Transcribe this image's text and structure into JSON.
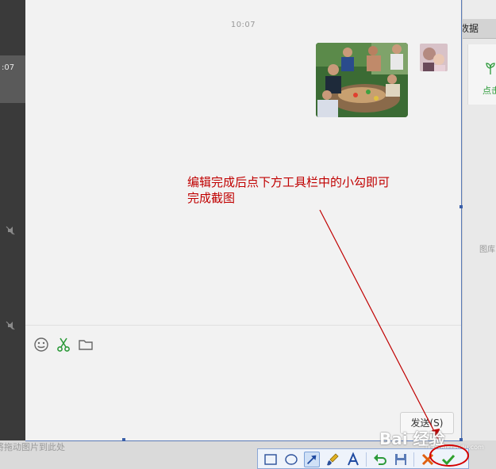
{
  "sidebar": {
    "time": ":07"
  },
  "right_panel": {
    "tab_label": "数据",
    "card_label": "点击",
    "library_label": "图库"
  },
  "chat": {
    "timestamp": "10:07",
    "photo_alt": "group photo",
    "send_label": "发送(S)"
  },
  "bottom": {
    "drop_hint": "将拖动图片到此处"
  },
  "annotation": {
    "text": "编辑完成后点下方工具栏中的小勾即可完成截图",
    "color": "#c00000"
  },
  "toolbar": {
    "items": [
      "rectangle-icon",
      "ellipse-icon",
      "arrow-icon",
      "brush-icon",
      "text-icon",
      "undo-icon",
      "save-icon",
      "cancel-icon",
      "confirm-icon"
    ]
  },
  "watermark": {
    "text": "Bai 经验",
    "sub": "jingyan.baidu.com"
  },
  "colors": {
    "selection_border": "#5a7bb7",
    "highlight": "#d40000",
    "accent_green": "#2c9a3a"
  }
}
